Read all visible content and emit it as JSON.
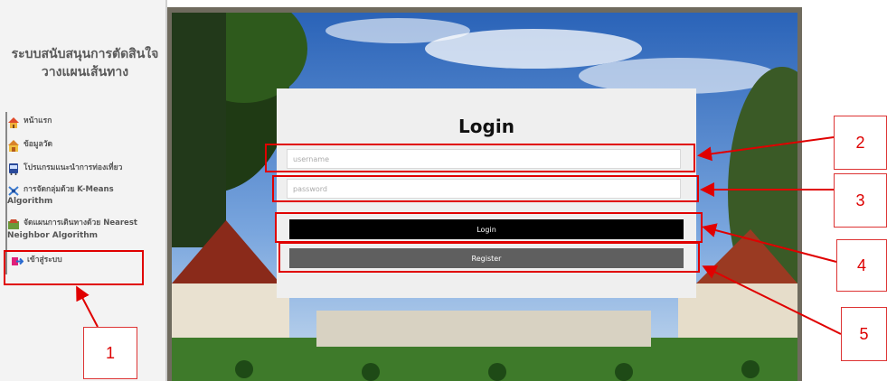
{
  "sidebar": {
    "title_line1": "ระบบสนับสนุนการตัดสินใจ",
    "title_line2": "วางแผนเส้นทาง",
    "items": [
      {
        "label": "หน้าแรก",
        "icon": "home-icon"
      },
      {
        "label": "ข้อมูลวัด",
        "icon": "temple-icon"
      },
      {
        "label": "โปรแกรมแนะนำการท่องเที่ยว",
        "icon": "bus-icon"
      },
      {
        "label_line1": "การจัดกลุ่มด้วย K-Means",
        "label_line2": "Algorithm",
        "icon": "cluster-icon"
      },
      {
        "label_line1": "จัดแผนการเดินทางด้วย Nearest",
        "label_line2": "Neighbor Algorithm",
        "icon": "route-icon"
      },
      {
        "label": "เข้าสู่ระบบ",
        "icon": "login-icon"
      }
    ]
  },
  "login": {
    "title": "Login",
    "username_placeholder": "username",
    "password_placeholder": "password",
    "login_button": "Login",
    "register_button": "Register"
  },
  "annotations": [
    "1",
    "2",
    "3",
    "4",
    "5"
  ],
  "colors": {
    "annotation": "#e00000",
    "login_btn": "#000000",
    "register_btn": "#5f5f5f"
  }
}
